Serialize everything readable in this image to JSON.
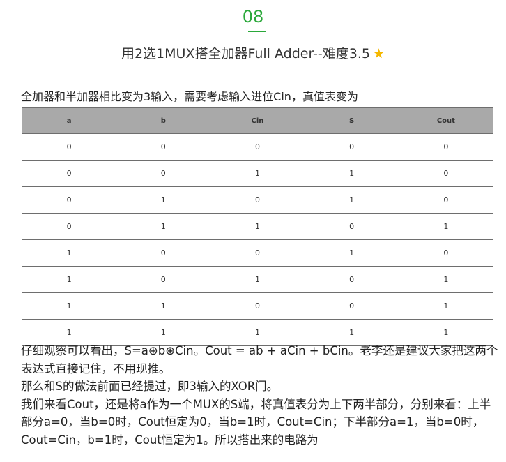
{
  "section": {
    "number": "08"
  },
  "title": {
    "text": "用2选1MUX搭全加器Full Adder--难度3.5",
    "star_icon": "star-icon"
  },
  "intro": "全加器和半加器相比变为3输入，需要考虑输入进位Cin，真值表变为",
  "truth_table": {
    "headers": [
      "a",
      "b",
      "Cin",
      "S",
      "Cout"
    ],
    "rows": [
      [
        "0",
        "0",
        "0",
        "0",
        "0"
      ],
      [
        "0",
        "0",
        "1",
        "1",
        "0"
      ],
      [
        "0",
        "1",
        "0",
        "1",
        "0"
      ],
      [
        "0",
        "1",
        "1",
        "0",
        "1"
      ],
      [
        "1",
        "0",
        "0",
        "1",
        "0"
      ],
      [
        "1",
        "0",
        "1",
        "0",
        "1"
      ],
      [
        "1",
        "1",
        "0",
        "0",
        "1"
      ],
      [
        "1",
        "1",
        "1",
        "1",
        "1"
      ]
    ]
  },
  "paragraphs": [
    "仔细观察可以看出，S=a⊕b⊕Cin。Cout = ab + aCin + bCin。老李还是建议大家把这两个表达式直接记住，不用现推。",
    "那么和S的做法前面已经提过，即3输入的XOR门。",
    "我们来看Cout，还是将a作为一个MUX的S端，将真值表分为上下两半部分，分别来看：上半部分a=0，当b=0时，Cout恒定为0，当b=1时，Cout=Cin；下半部分a=1，当b=0时，Cout=Cin，b=1时，Cout恒定为1。所以搭出来的电路为"
  ],
  "colors": {
    "accent": "#2aa83a",
    "header_bg": "#a9a9a9",
    "star": "#f5b800"
  }
}
